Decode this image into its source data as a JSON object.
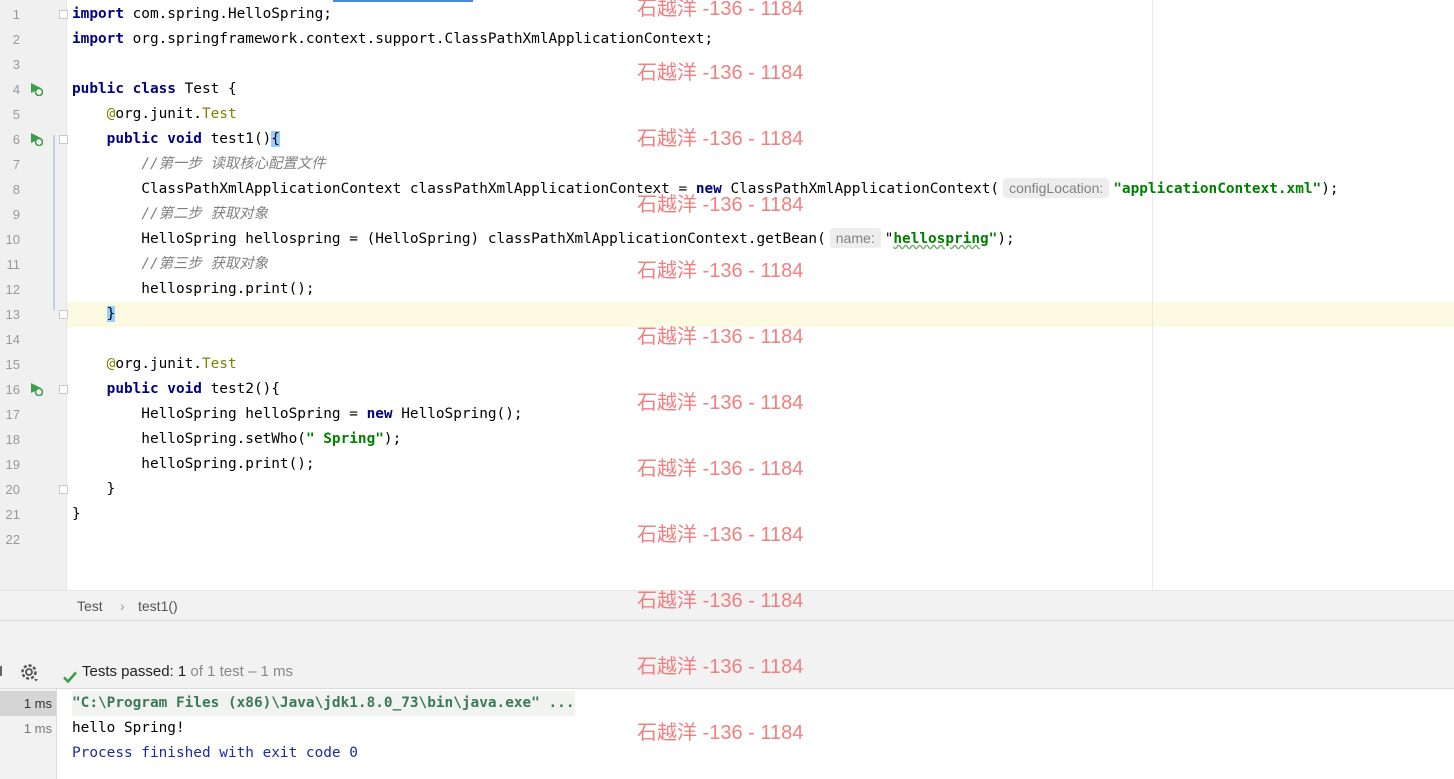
{
  "editor": {
    "line_numbers": [
      "1",
      "2",
      "3",
      "4",
      "5",
      "6",
      "7",
      "8",
      "9",
      "10",
      "11",
      "12",
      "13",
      "14",
      "15",
      "16",
      "17",
      "18",
      "19",
      "20",
      "21",
      "22"
    ],
    "code_lines": [
      [
        {
          "t": "import",
          "c": "kw"
        },
        {
          "t": " com.spring.HelloSpring;"
        }
      ],
      [
        {
          "t": "import",
          "c": "kw"
        },
        {
          "t": " org.springframework.context.support.ClassPathXmlApplicationContext;"
        }
      ],
      [],
      [
        {
          "t": "public class",
          "c": "kw"
        },
        {
          "t": " Test {"
        }
      ],
      [
        {
          "t": "    "
        },
        {
          "t": "@",
          "c": "ann"
        },
        {
          "t": "org.junit."
        },
        {
          "t": "Test",
          "c": "ann"
        }
      ],
      [
        {
          "t": "    "
        },
        {
          "t": "public void",
          "c": "kw"
        },
        {
          "t": " test1()"
        },
        {
          "t": "{",
          "c": "brace-hl"
        }
      ],
      [
        {
          "t": "        "
        },
        {
          "t": "//第一步 读取核心配置文件",
          "c": "cm"
        }
      ],
      [
        {
          "t": "        ClassPathXmlApplicationContext classPathXmlApplicationContext = "
        },
        {
          "t": "new",
          "c": "kw"
        },
        {
          "t": " ClassPathXmlApplicationContext("
        },
        {
          "t": "configLocation:",
          "c": "hint"
        },
        {
          "t": "\"applicationContext.xml\"",
          "c": "str"
        },
        {
          "t": ");"
        }
      ],
      [
        {
          "t": "        "
        },
        {
          "t": "//第二步 获取对象",
          "c": "cm"
        }
      ],
      [
        {
          "t": "        HelloSpring hellospring = (HelloSpring) classPathXmlApplicationContext.getBean("
        },
        {
          "t": "name:",
          "c": "hint"
        },
        {
          "t": "\""
        },
        {
          "t": "hellospring",
          "c": "str wavy"
        },
        {
          "t": "\"",
          "c": "str"
        },
        {
          "t": ");"
        }
      ],
      [
        {
          "t": "        "
        },
        {
          "t": "//第三步 获取对象",
          "c": "cm"
        }
      ],
      [
        {
          "t": "        hellospring.print();"
        }
      ],
      [
        {
          "t": "    "
        },
        {
          "t": "}",
          "c": "brace-hl"
        }
      ],
      [],
      [
        {
          "t": "    "
        },
        {
          "t": "@",
          "c": "ann"
        },
        {
          "t": "org.junit."
        },
        {
          "t": "Test",
          "c": "ann"
        }
      ],
      [
        {
          "t": "    "
        },
        {
          "t": "public void",
          "c": "kw"
        },
        {
          "t": " test2(){"
        }
      ],
      [
        {
          "t": "        HelloSpring helloSpring = "
        },
        {
          "t": "new",
          "c": "kw"
        },
        {
          "t": " HelloSpring();"
        }
      ],
      [
        {
          "t": "        helloSpring.setWho("
        },
        {
          "t": "\" Spring\"",
          "c": "str"
        },
        {
          "t": ");"
        }
      ],
      [
        {
          "t": "        helloSpring.print();"
        }
      ],
      [
        {
          "t": "    }"
        }
      ],
      [
        {
          "t": "}"
        }
      ],
      []
    ]
  },
  "breadcrumb": {
    "class": "Test",
    "sep": "›",
    "method": "test1()"
  },
  "run_toolbar": {
    "status_label": "Tests passed:",
    "passed": "1",
    "suffix": "of 1 test – 1 ms"
  },
  "test_tree": {
    "rows": [
      "1 ms",
      "1 ms"
    ]
  },
  "console": {
    "command": "\"C:\\Program Files (x86)\\Java\\jdk1.8.0_73\\bin\\java.exe\" ...",
    "output": "hello Spring!",
    "exit": "Process finished with exit code 0"
  },
  "watermark": {
    "text": "石越洋 -136 - 1184"
  },
  "colors": {
    "keyword": "#000080",
    "annotation": "#808000",
    "string": "#008000",
    "comment": "#808080",
    "console_blue": "#1d2a9e",
    "watermark": "#f08080"
  }
}
